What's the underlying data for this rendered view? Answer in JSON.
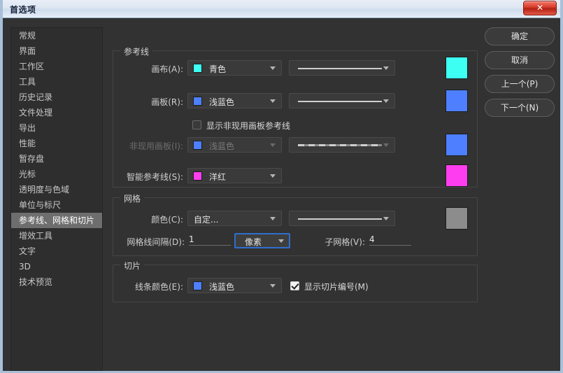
{
  "window": {
    "title": "首选项",
    "close_label": "✕"
  },
  "sidebar": {
    "items": [
      {
        "label": "常规",
        "selected": false
      },
      {
        "label": "界面",
        "selected": false
      },
      {
        "label": "工作区",
        "selected": false
      },
      {
        "label": "工具",
        "selected": false
      },
      {
        "label": "历史记录",
        "selected": false
      },
      {
        "label": "文件处理",
        "selected": false
      },
      {
        "label": "导出",
        "selected": false
      },
      {
        "label": "性能",
        "selected": false
      },
      {
        "label": "暂存盘",
        "selected": false
      },
      {
        "label": "光标",
        "selected": false
      },
      {
        "label": "透明度与色域",
        "selected": false
      },
      {
        "label": "单位与标尺",
        "selected": false
      },
      {
        "label": "参考线、网格和切片",
        "selected": true
      },
      {
        "label": "增效工具",
        "selected": false
      },
      {
        "label": "文字",
        "selected": false
      },
      {
        "label": "3D",
        "selected": false
      },
      {
        "label": "技术预览",
        "selected": false
      }
    ]
  },
  "buttons": {
    "ok": "确定",
    "cancel": "取消",
    "prev": "上一个(P)",
    "next": "下一个(N)"
  },
  "guides": {
    "title": "参考线",
    "canvas": {
      "label": "画布(A):",
      "color_value": "青色",
      "color_hex": "#3DFFF2",
      "style": "solid",
      "swatch_hex": "#3DFFF2"
    },
    "artboard": {
      "label": "画板(R):",
      "color_value": "浅蓝色",
      "color_hex": "#4D7FFF",
      "style": "solid",
      "swatch_hex": "#4D7FFF"
    },
    "show_inactive": {
      "label": "显示非现用画板参考线",
      "checked": false
    },
    "inactive_artboard": {
      "label": "非现用画板(I):",
      "color_value": "浅蓝色",
      "color_hex": "#4D7FFF",
      "style": "dashed",
      "swatch_hex": "#4D7FFF",
      "disabled": true
    },
    "smart_guides": {
      "label": "智能参考线(S):",
      "color_value": "洋红",
      "color_hex": "#FF3DF0",
      "swatch_hex": "#FF3DF0"
    }
  },
  "grid": {
    "title": "网格",
    "color": {
      "label": "颜色(C):",
      "value": "自定...",
      "style": "solid",
      "swatch_hex": "#8C8C8C"
    },
    "gridline_every": {
      "label": "网格线间隔(D):",
      "value": "1"
    },
    "unit": {
      "value": "像素",
      "focused": true
    },
    "subdivisions": {
      "label": "子网格(V):",
      "value": "4"
    }
  },
  "slices": {
    "title": "切片",
    "line_color": {
      "label": "线条颜色(E):",
      "value": "浅蓝色",
      "color_hex": "#4D7FFF"
    },
    "show_numbers": {
      "label": "显示切片编号(M)",
      "checked": true
    }
  }
}
